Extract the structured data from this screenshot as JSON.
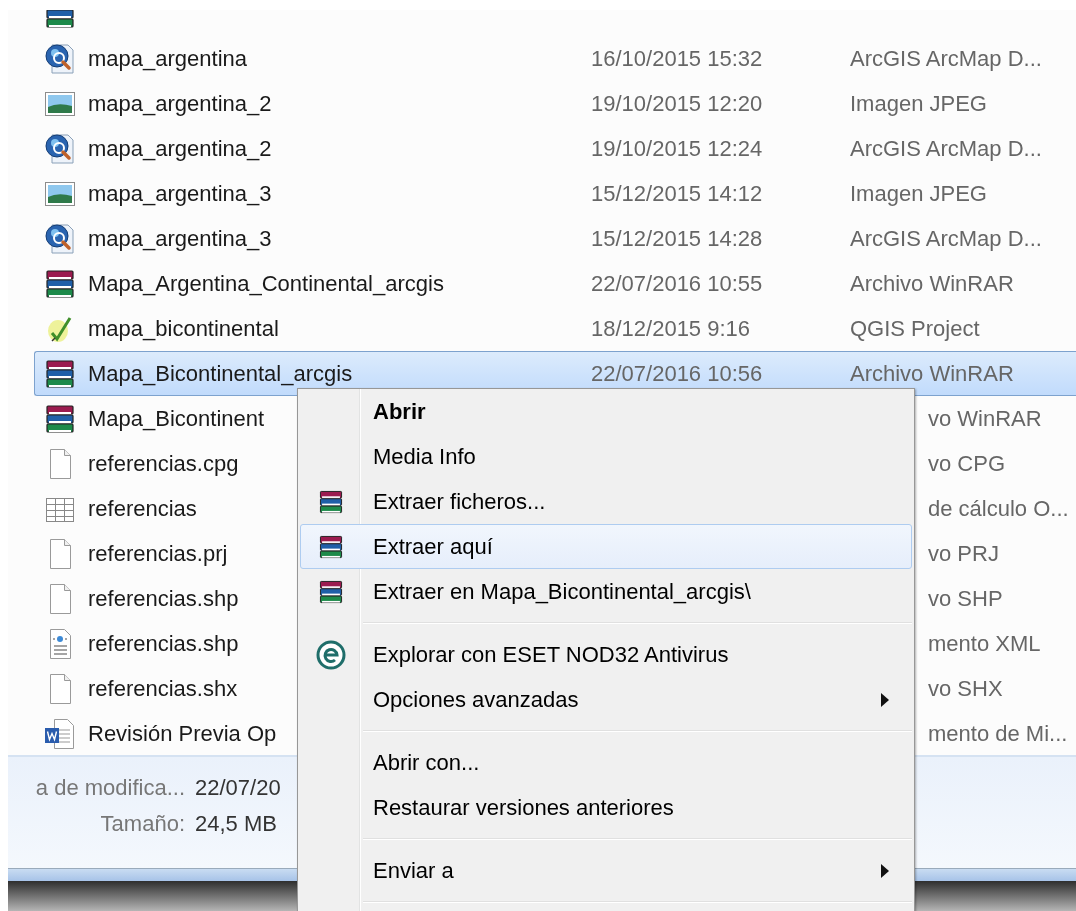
{
  "files": [
    {
      "kind": "winrar",
      "selected": false
    },
    {
      "name": "mapa_argentina",
      "modified": "16/10/2015 15:32",
      "type": "ArcGIS ArcMap D...",
      "kind": "arcmap",
      "selected": false
    },
    {
      "name": "mapa_argentina_2",
      "modified": "19/10/2015 12:20",
      "type": "Imagen JPEG",
      "kind": "jpeg",
      "selected": false
    },
    {
      "name": "mapa_argentina_2",
      "modified": "19/10/2015 12:24",
      "type": "ArcGIS ArcMap D...",
      "kind": "arcmap",
      "selected": false
    },
    {
      "name": "mapa_argentina_3",
      "modified": "15/12/2015 14:12",
      "type": "Imagen JPEG",
      "kind": "jpeg",
      "selected": false
    },
    {
      "name": "mapa_argentina_3",
      "modified": "15/12/2015 14:28",
      "type": "ArcGIS ArcMap D...",
      "kind": "arcmap",
      "selected": false
    },
    {
      "name": "Mapa_Argentina_Continental_arcgis",
      "modified": "22/07/2016 10:55",
      "type": "Archivo WinRAR",
      "kind": "winrar",
      "selected": false
    },
    {
      "name": "mapa_bicontinental",
      "modified": "18/12/2015 9:16",
      "type": "QGIS Project",
      "kind": "qgis",
      "selected": false
    },
    {
      "name": "Mapa_Bicontinental_arcgis",
      "modified": "22/07/2016 10:56",
      "type": "Archivo WinRAR",
      "kind": "winrar",
      "selected": true
    },
    {
      "name": "Mapa_Bicontinent",
      "type": "vo WinRAR",
      "kind": "winrar",
      "selected": false
    },
    {
      "name": "referencias.cpg",
      "type": "vo CPG",
      "kind": "blank",
      "selected": false
    },
    {
      "name": "referencias",
      "type": "de cálculo O...",
      "kind": "sheet",
      "selected": false
    },
    {
      "name": "referencias.prj",
      "type": "vo PRJ",
      "kind": "blank",
      "selected": false
    },
    {
      "name": "referencias.shp",
      "type": "vo SHP",
      "kind": "blank",
      "selected": false
    },
    {
      "name": "referencias.shp",
      "type": "mento XML",
      "kind": "xml",
      "selected": false
    },
    {
      "name": "referencias.shx",
      "type": "vo SHX",
      "kind": "blank",
      "selected": false
    },
    {
      "name": "Revisión Previa Op",
      "type": "mento de Mi...",
      "kind": "word",
      "selected": false
    }
  ],
  "details": [
    {
      "label": "a de modifica...",
      "value": "22/07/20"
    },
    {
      "label": "Tamaño:",
      "value": "24,5 MB"
    }
  ],
  "context_menu": [
    {
      "kind": "plain",
      "label": "Abrir",
      "default": true,
      "submenu": false,
      "selected": false
    },
    {
      "kind": "plain",
      "label": "Media Info",
      "default": false,
      "submenu": false,
      "selected": false
    },
    {
      "kind": "archive",
      "label": "Extraer ficheros...",
      "default": false,
      "submenu": false,
      "selected": false
    },
    {
      "kind": "archive",
      "label": "Extraer aquí",
      "default": false,
      "submenu": false,
      "selected": true
    },
    {
      "kind": "archive",
      "label": "Extraer en Mapa_Bicontinental_arcgis\\",
      "default": false,
      "submenu": false,
      "selected": false
    },
    {
      "kind": "separator"
    },
    {
      "kind": "antivirus",
      "label": "Explorar con ESET NOD32 Antivirus",
      "default": false,
      "submenu": false,
      "selected": false
    },
    {
      "kind": "plain",
      "label": "Opciones avanzadas",
      "default": false,
      "submenu": true,
      "selected": false
    },
    {
      "kind": "separator"
    },
    {
      "kind": "plain",
      "label": "Abrir con...",
      "default": false,
      "submenu": false,
      "selected": false
    },
    {
      "kind": "plain",
      "label": "Restaurar versiones anteriores",
      "default": false,
      "submenu": false,
      "selected": false
    },
    {
      "kind": "separator"
    },
    {
      "kind": "plain",
      "label": "Enviar a",
      "default": false,
      "submenu": true,
      "selected": false
    },
    {
      "kind": "separator"
    }
  ]
}
